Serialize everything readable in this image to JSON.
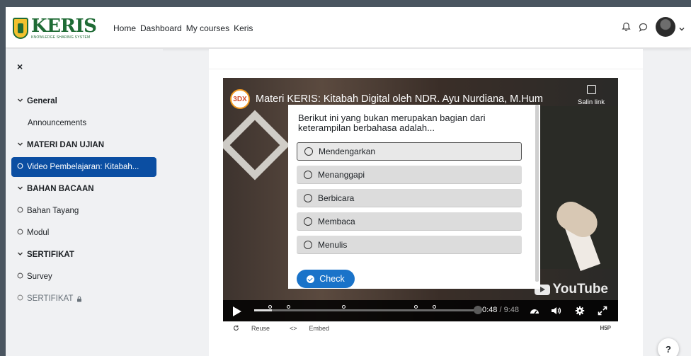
{
  "brand": {
    "name": "KERIS",
    "tagline": "KNOWLEDGE SHARING SYSTEM"
  },
  "nav": {
    "links": [
      "Home",
      "Dashboard",
      "My courses",
      "Keris"
    ]
  },
  "sidebar": {
    "close_label": "×",
    "items": [
      {
        "label": "General",
        "kind": "section"
      },
      {
        "label": "Announcements",
        "kind": "item"
      },
      {
        "label": "MATERI DAN UJIAN",
        "kind": "section"
      },
      {
        "label": "Video Pembelajaran: Kitabah...",
        "kind": "active"
      },
      {
        "label": "BAHAN BACAAN",
        "kind": "section"
      },
      {
        "label": "Bahan Tayang",
        "kind": "item"
      },
      {
        "label": "Modul",
        "kind": "item"
      },
      {
        "label": "SERTIFIKAT",
        "kind": "section"
      },
      {
        "label": "Survey",
        "kind": "item"
      },
      {
        "label": "SERTIFIKAT",
        "kind": "locked"
      }
    ]
  },
  "video": {
    "channel_badge": "3DX",
    "title": "Materi KERIS: Kitabah Digital oleh NDR. Ayu Nurdiana, M.Hum",
    "copy_link_label": "Salin link",
    "youtube_label": "YouTube",
    "time_current": "0:48",
    "time_separator": "/",
    "time_total": "9:48",
    "progress": 0.08
  },
  "quiz": {
    "question": "Berikut ini yang bukan merupakan bagian dari keterampilan berbahasa adalah...",
    "options": [
      "Mendengarkan",
      "Menanggapi",
      "Berbicara",
      "Membaca",
      "Menulis"
    ],
    "selected_index": 0,
    "check_label": "Check"
  },
  "h5p_bar": {
    "reuse_label": "Reuse",
    "embed_label": "Embed",
    "h5p_label": "H5P"
  },
  "help_label": "?"
}
